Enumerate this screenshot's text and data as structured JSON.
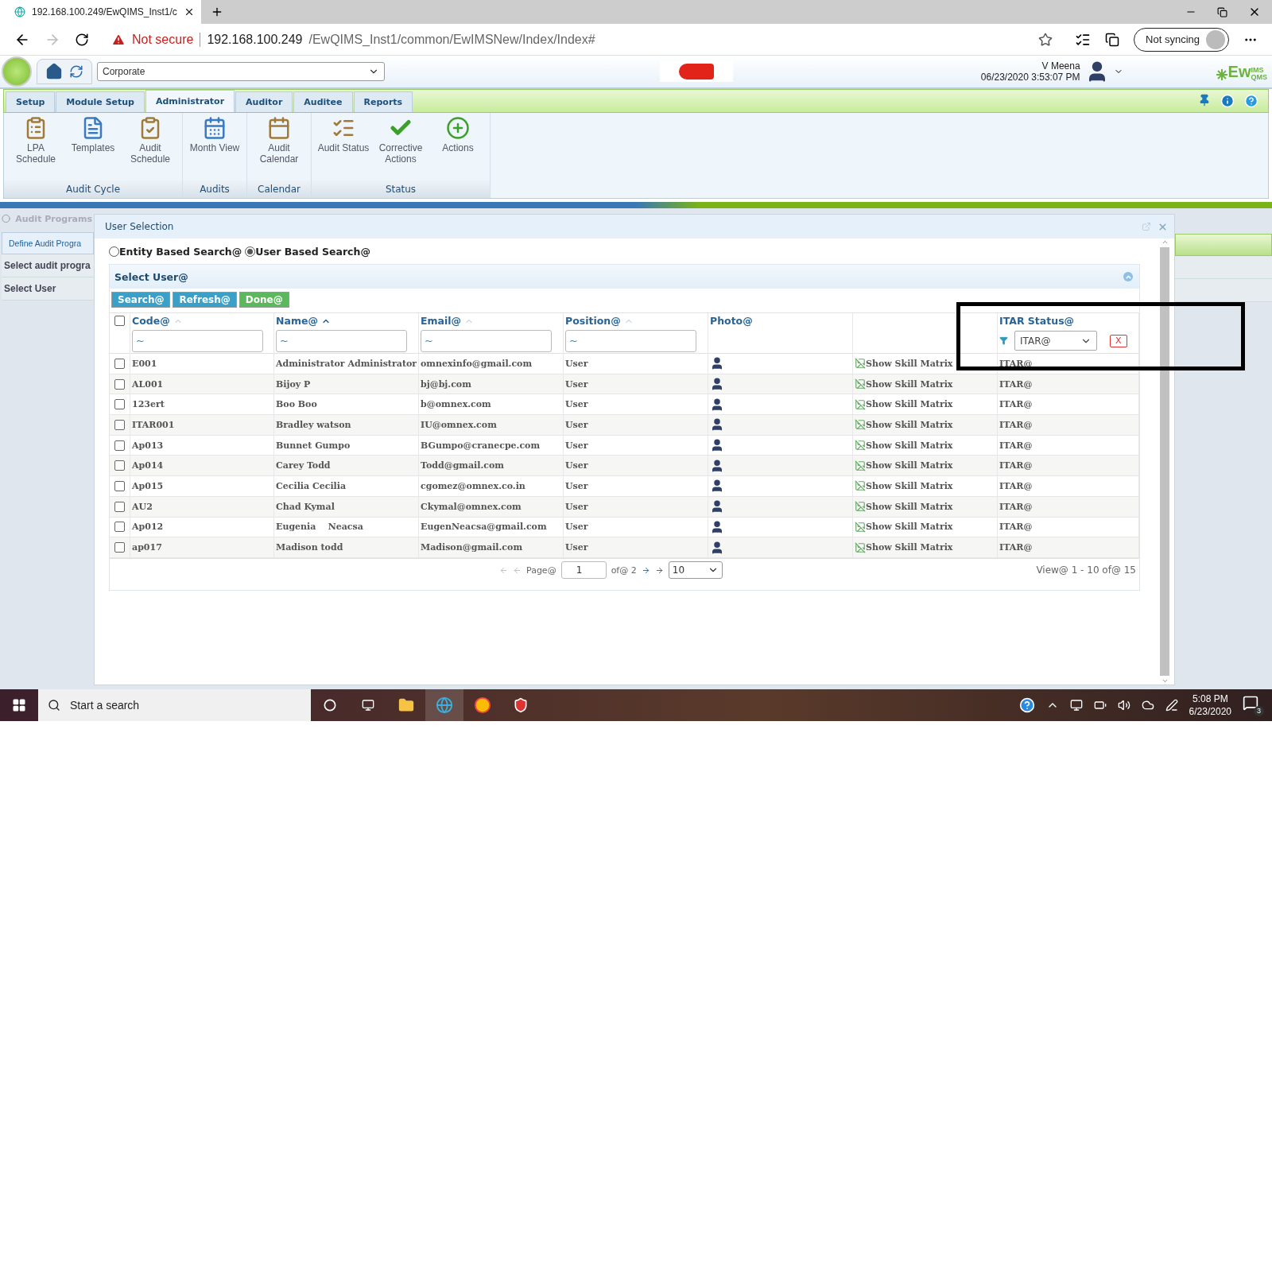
{
  "browser": {
    "tab_title": "192.168.100.249/EwQIMS_Inst1/c",
    "security": "Not secure",
    "url_host": "192.168.100.249",
    "url_path": "/EwQIMS_Inst1/common/EwIMSNew/Index/Index#",
    "sync": "Not syncing"
  },
  "app_header": {
    "organization": "Corporate",
    "user_name": "V Meena",
    "datetime": "06/23/2020 3:53:07 PM",
    "logo_top": "IMS",
    "logo_main": "Ew",
    "logo_sub": "QMS"
  },
  "ribbon": {
    "tabs": [
      {
        "label": "Setup",
        "selected": false
      },
      {
        "label": "Module Setup",
        "selected": false
      },
      {
        "label": "Administrator",
        "selected": true
      },
      {
        "label": "Auditor",
        "selected": false
      },
      {
        "label": "Auditee",
        "selected": false
      },
      {
        "label": "Reports",
        "selected": false
      }
    ],
    "groups": [
      {
        "label": "Audit Cycle",
        "items": [
          {
            "label": "LPA Schedule",
            "kind": "schedule"
          },
          {
            "label": "Templates",
            "kind": "template"
          },
          {
            "label": "Audit Schedule",
            "kind": "clipboard"
          }
        ]
      },
      {
        "label": "Audits",
        "items": [
          {
            "label": "Month View",
            "kind": "month"
          }
        ]
      },
      {
        "label": "Calendar",
        "items": [
          {
            "label": "Audit Calendar",
            "kind": "calendar"
          }
        ]
      },
      {
        "label": "Status",
        "items": [
          {
            "label": "Audit Status",
            "kind": "status"
          },
          {
            "label": "Corrective Actions",
            "kind": "check"
          },
          {
            "label": "Actions",
            "kind": "actions"
          }
        ]
      }
    ]
  },
  "background": {
    "breadcrumb": "Audit Programs",
    "tab": "Define Audit Progra",
    "rows": [
      "Select audit progra",
      "Select User"
    ]
  },
  "dialog": {
    "title": "User Selection",
    "search_modes": [
      {
        "label": "Entity Based Search@",
        "selected": false
      },
      {
        "label": "User Based Search@",
        "selected": true
      }
    ],
    "panel_title": "Select User@",
    "buttons": [
      {
        "label": "Search@",
        "kind": "primary"
      },
      {
        "label": "Refresh@",
        "kind": "primary"
      },
      {
        "label": "Done@",
        "kind": "success"
      }
    ],
    "select_all_checked": false,
    "columns": [
      {
        "label": "Code@",
        "sorted": false,
        "filter": "~"
      },
      {
        "label": "Name@",
        "sorted": true,
        "filter": "~"
      },
      {
        "label": "Email@",
        "sorted": false,
        "filter": "~"
      },
      {
        "label": "Position@",
        "sorted": false,
        "filter": "~"
      },
      {
        "label": "Photo@"
      },
      {},
      {
        "label": "ITAR Status@"
      }
    ],
    "itar_filter": {
      "value": "ITAR@",
      "clear": "X"
    },
    "rows": [
      {
        "checked": false,
        "code": "E001",
        "name": "Administrator Administrator",
        "email": "omnexinfo@gmail.com",
        "position": "User",
        "skill": "Show Skill Matrix",
        "itar": "ITAR@"
      },
      {
        "checked": false,
        "code": "AL001",
        "name": "Bijoy P",
        "email": "bj@bj.com",
        "position": "User",
        "skill": "Show Skill Matrix",
        "itar": "ITAR@"
      },
      {
        "checked": false,
        "code": "123ert",
        "name": "Boo Boo",
        "email": "b@omnex.com",
        "position": "User",
        "skill": "Show Skill Matrix",
        "itar": "ITAR@"
      },
      {
        "checked": false,
        "code": "ITAR001",
        "name": "Bradley watson",
        "email": "IU@omnex.com",
        "position": "User",
        "skill": "Show Skill Matrix",
        "itar": "ITAR@"
      },
      {
        "checked": false,
        "code": "Ap013",
        "name": "Bunnet Gumpo",
        "email": "BGumpo@cranecpe.com",
        "position": "User",
        "skill": "Show Skill Matrix",
        "itar": "ITAR@"
      },
      {
        "checked": false,
        "code": "Ap014",
        "name": "Carey Todd",
        "email": "Todd@gmail.com",
        "position": "User",
        "skill": "Show Skill Matrix",
        "itar": "ITAR@"
      },
      {
        "checked": false,
        "code": "Ap015",
        "name": "Cecilia Cecilia",
        "email": "cgomez@omnex.co.in",
        "position": "User",
        "skill": "Show Skill Matrix",
        "itar": "ITAR@"
      },
      {
        "checked": false,
        "code": "AU2",
        "name": "Chad Kymal",
        "email": "Ckymal@omnex.com",
        "position": "User",
        "skill": "Show Skill Matrix",
        "itar": "ITAR@"
      },
      {
        "checked": false,
        "code": "Ap012",
        "name": "Eugenia    Neacsa",
        "email": "EugenNeacsa@gmail.com",
        "position": "User",
        "skill": "Show Skill Matrix",
        "itar": "ITAR@"
      },
      {
        "checked": false,
        "code": "ap017",
        "name": "Madison todd",
        "email": "Madison@gmail.com",
        "position": "User",
        "skill": "Show Skill Matrix",
        "itar": "ITAR@"
      }
    ],
    "pager": {
      "page_label": "Page@",
      "page": "1",
      "of": "of@ 2",
      "page_size": "10",
      "view": "View@ 1 - 10 of@ 15"
    }
  },
  "taskbar": {
    "search_placeholder": "Start a search",
    "time": "5:08 PM",
    "date": "6/23/2020",
    "notifications": "3"
  }
}
